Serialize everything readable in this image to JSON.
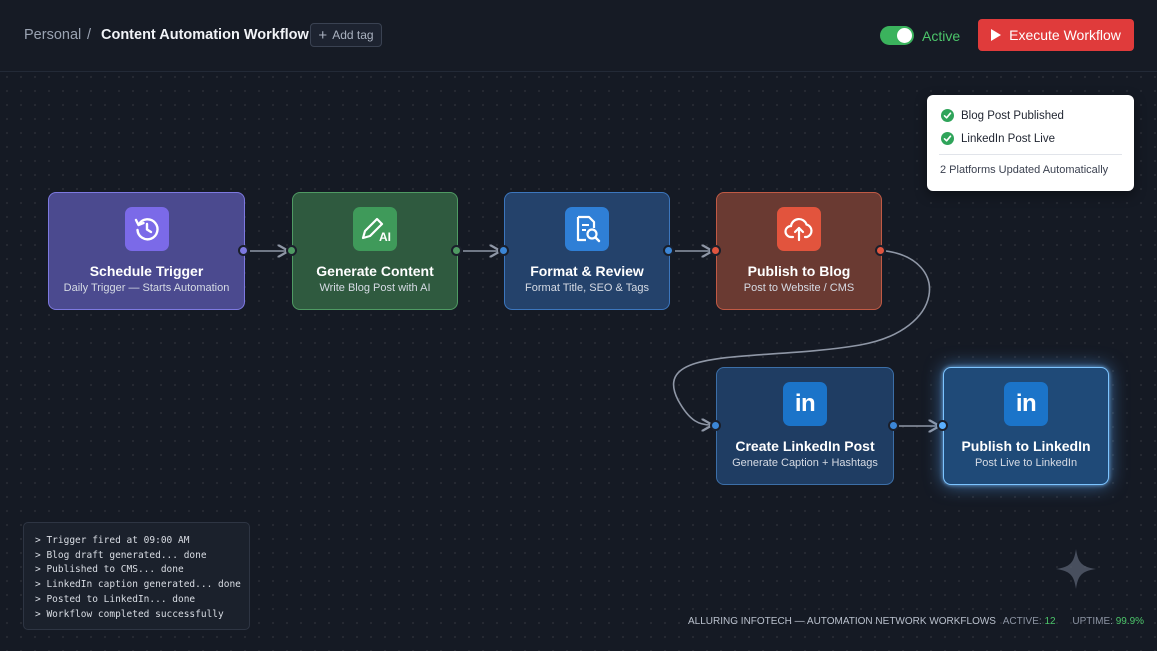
{
  "header": {
    "breadcrumb_root": "Personal",
    "breadcrumb_sep": "/",
    "workflow_title": "Content Automation Workflow",
    "add_tag_label": "Add tag",
    "status_label": "Active",
    "status_on": true,
    "execute_label": "Execute Workflow"
  },
  "nodes": [
    {
      "title": "Schedule Trigger",
      "subtitle": "Daily Trigger — Starts Automation",
      "icon": "clock-icon"
    },
    {
      "title": "Generate Content",
      "subtitle": "Write Blog Post with AI",
      "icon": "ai-pen-icon",
      "icon_text": "AI"
    },
    {
      "title": "Format & Review",
      "subtitle": "Format Title, SEO & Tags",
      "icon": "document-search-icon"
    },
    {
      "title": "Publish to Blog",
      "subtitle": "Post to Website / CMS",
      "icon": "cloud-upload-icon"
    },
    {
      "title": "Create LinkedIn Post",
      "subtitle": "Generate Caption + Hashtags",
      "icon": "linkedin-icon",
      "icon_text": "in"
    },
    {
      "title": "Publish to LinkedIn",
      "subtitle": "Post Live to LinkedIn",
      "icon": "linkedin-icon",
      "icon_text": "in"
    }
  ],
  "notification": {
    "items": [
      "Blog Post Published",
      "LinkedIn Post Live"
    ],
    "summary": "2 Platforms Updated Automatically"
  },
  "log": {
    "lines": [
      "> Trigger fired at 09:00 AM",
      "> Blog draft generated... done",
      "> Published to CMS... done",
      "> LinkedIn caption generated... done",
      "> Posted to LinkedIn... done",
      "> Workflow completed successfully"
    ]
  },
  "footer": {
    "brand": "ALLURING INFOTECH — AUTOMATION NETWORK WORKFLOWS",
    "active_label": "ACTIVE:",
    "active_value": "12",
    "uptime_label": "UPTIME:",
    "uptime_value": "99.9%"
  },
  "colors": {
    "accent_red": "#e03b3b",
    "active_green": "#3bb35d",
    "trigger_purple": "#7b6ae8",
    "generate_green": "#3f9a5a",
    "format_blue": "#2f7fd6",
    "blog_orange": "#e2543d",
    "linkedin_blue": "#1b74c9"
  }
}
